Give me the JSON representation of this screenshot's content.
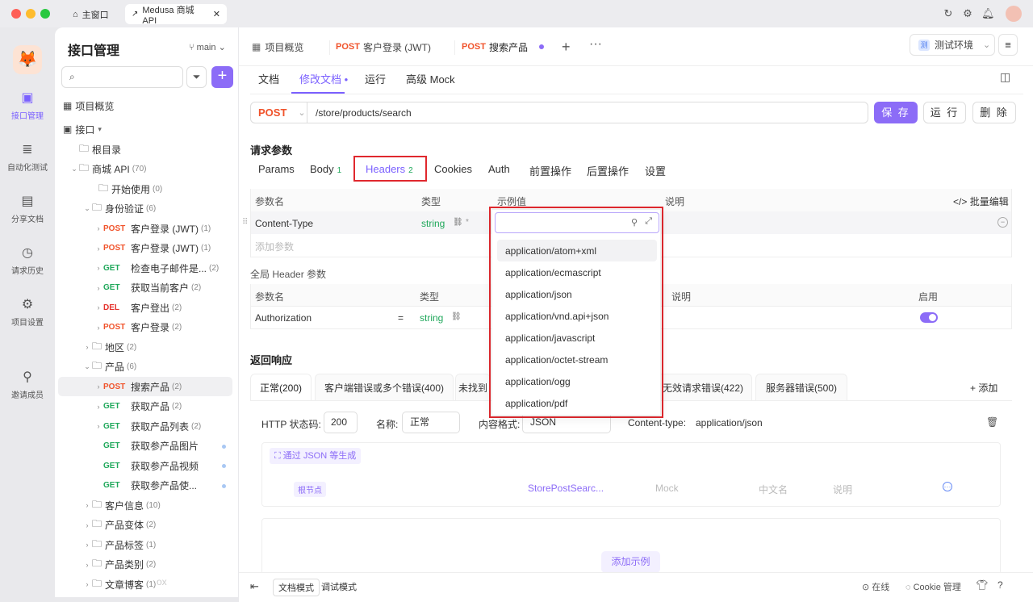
{
  "window": {
    "tabs": [
      {
        "label": "主窗口"
      },
      {
        "label": "Medusa 商城 API"
      }
    ]
  },
  "rail": {
    "items": [
      {
        "label": "接口管理",
        "icon": "api-icon",
        "active": true
      },
      {
        "label": "自动化测试",
        "icon": "automation-icon"
      },
      {
        "label": "分享文档",
        "icon": "share-doc-icon"
      },
      {
        "label": "请求历史",
        "icon": "history-icon"
      },
      {
        "label": "项目设置",
        "icon": "settings-icon"
      },
      {
        "label": "邀请成员",
        "icon": "invite-icon"
      }
    ]
  },
  "tree": {
    "title": "接口管理",
    "branch": "main",
    "overview": "项目概览",
    "api_root": "接口",
    "rows": [
      {
        "label": "根目录",
        "type": "folder",
        "count": ""
      },
      {
        "label": "商城 API",
        "type": "folder",
        "count": "(70)"
      },
      {
        "label": "开始使用",
        "type": "folder",
        "count": "(0)"
      },
      {
        "label": "身份验证",
        "type": "folder",
        "count": "(6)"
      },
      {
        "method": "POST",
        "label": "客户登录 (JWT)",
        "count": "(1)"
      },
      {
        "method": "POST",
        "label": "客户登录 (JWT)",
        "count": "(1)"
      },
      {
        "method": "GET",
        "label": "检查电子邮件是...",
        "count": "(2)"
      },
      {
        "method": "GET",
        "label": "获取当前客户",
        "count": "(2)"
      },
      {
        "method": "DEL",
        "label": "客户登出",
        "count": "(2)"
      },
      {
        "method": "POST",
        "label": "客户登录",
        "count": "(2)"
      },
      {
        "label": "地区",
        "type": "folder",
        "count": "(2)"
      },
      {
        "label": "产品",
        "type": "folder",
        "count": "(6)"
      },
      {
        "method": "POST",
        "label": "搜索产品",
        "count": "(2)"
      },
      {
        "method": "GET",
        "label": "获取产品",
        "count": "(2)"
      },
      {
        "method": "GET",
        "label": "获取产品列表",
        "count": "(2)"
      },
      {
        "method": "GET",
        "label": "获取参产品图片",
        "count": ""
      },
      {
        "method": "GET",
        "label": "获取参产品视频",
        "count": ""
      },
      {
        "method": "GET",
        "label": "获取参产品使...",
        "count": ""
      },
      {
        "label": "客户信息",
        "type": "folder",
        "count": "(10)"
      },
      {
        "label": "产品变体",
        "type": "folder",
        "count": "(2)"
      },
      {
        "label": "产品标签",
        "type": "folder",
        "count": "(1)"
      },
      {
        "label": "产品类别",
        "type": "folder",
        "count": "(2)"
      },
      {
        "label": "文章博客",
        "type": "folder",
        "count": "(1)"
      }
    ],
    "watermark": "ox"
  },
  "doc_tabs": [
    {
      "method": "",
      "label": "项目概览"
    },
    {
      "method": "POST",
      "label": "客户登录 (JWT)"
    },
    {
      "method": "POST",
      "label": "搜索产品"
    }
  ],
  "env": {
    "badge": "测",
    "label": "测试环境"
  },
  "subtabs": [
    "文档",
    "修改文档 •",
    "运行",
    "高级 Mock"
  ],
  "request": {
    "method": "POST",
    "url": "/store/products/search",
    "save": "保 存",
    "run": "运 行",
    "delete": "删 除"
  },
  "params": {
    "title": "请求参数",
    "tabs": [
      {
        "label": "Params",
        "badge": ""
      },
      {
        "label": "Body",
        "badge": "1"
      },
      {
        "label": "Headers",
        "badge": "2"
      },
      {
        "label": "Cookies",
        "badge": ""
      },
      {
        "label": "Auth",
        "badge": ""
      },
      {
        "label": "前置操作",
        "badge": ""
      },
      {
        "label": "后置操作",
        "badge": ""
      },
      {
        "label": "设置",
        "badge": ""
      }
    ],
    "headers": [
      "参数名",
      "类型",
      "示例值",
      "说明"
    ],
    "bulk_edit": "批量编辑",
    "row": {
      "name": "Content-Type",
      "type": "string"
    },
    "add_placeholder": "添加参数"
  },
  "global": {
    "title": "全局 Header 参数",
    "headers": [
      "参数名",
      "类型",
      "说明",
      "启用"
    ],
    "row": {
      "name": "Authorization",
      "eq": "=",
      "type": "string",
      "enabled": true
    }
  },
  "dropdown": {
    "options": [
      "application/atom+xml",
      "application/ecmascript",
      "application/json",
      "application/vnd.api+json",
      "application/javascript",
      "application/octet-stream",
      "application/ogg",
      "application/pdf"
    ]
  },
  "response": {
    "title": "返回响应",
    "tabs": [
      "正常(200)",
      "客户端错误或多个错误(400)",
      "未找到",
      "无效请求错误(422)",
      "服务器错误(500)"
    ],
    "add": "添加",
    "status_label": "HTTP 状态码:",
    "status": "200",
    "name_label": "名称:",
    "name": "正常",
    "format_label": "内容格式:",
    "format": "JSON",
    "ctype_label": "Content-type:",
    "ctype": "application/json",
    "gen_json": "通过 JSON 等生成",
    "root": "根节点",
    "schema": "StorePostSearc...",
    "mock": "Mock",
    "cn": "中文名",
    "desc": "说明",
    "add_example": "添加示例"
  },
  "status": {
    "doc_mode": "文档模式",
    "debug_mode": "调试模式",
    "online": "在线",
    "cookie": "Cookie 管理"
  }
}
